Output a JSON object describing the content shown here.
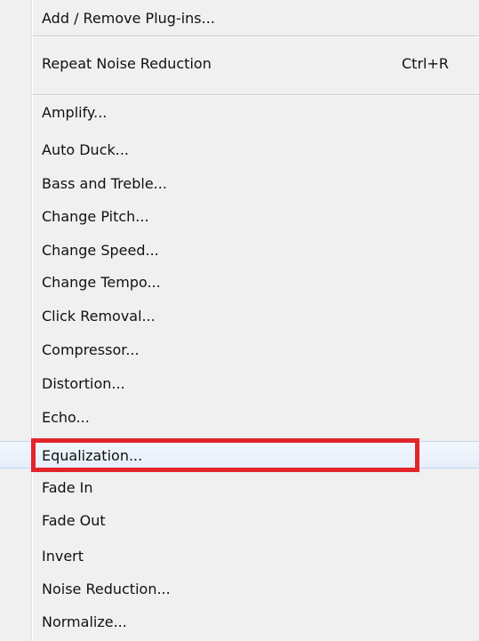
{
  "menu": {
    "plugins_item": "Add / Remove Plug-ins...",
    "repeat_item": {
      "label": "Repeat Noise Reduction",
      "shortcut": "Ctrl+R"
    },
    "effects": [
      "Amplify...",
      "Auto Duck...",
      "Bass and Treble...",
      "Change Pitch...",
      "Change Speed...",
      "Change Tempo...",
      "Click Removal...",
      "Compressor...",
      "Distortion...",
      "Echo...",
      "Equalization...",
      "Fade In",
      "Fade Out",
      "Invert",
      "Noise Reduction...",
      "Normalize..."
    ],
    "highlighted_item": "Equalization...",
    "annotation_color": "#e3242b"
  }
}
